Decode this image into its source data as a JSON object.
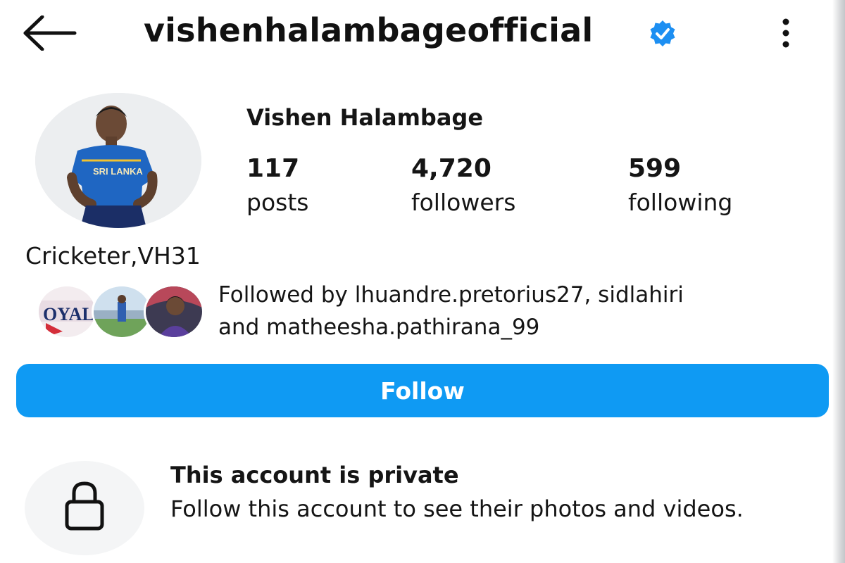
{
  "header": {
    "username": "vishenhalambageofficial",
    "back_icon": "arrow-left-icon",
    "verified_icon": "verified-badge-icon",
    "more_icon": "more-vertical-icon"
  },
  "profile": {
    "full_name": "Vishen Halambage",
    "bio": "Cricketer,VH31",
    "stats": [
      {
        "number": "117",
        "label": "posts"
      },
      {
        "number": "4,720",
        "label": "followers"
      },
      {
        "number": "599",
        "label": "following"
      }
    ],
    "followed_by_line1": "Followed by lhuandre.pretorius27, sidlahiri",
    "followed_by_line2": "and matheesha.pathirana_99"
  },
  "actions": {
    "follow_label": "Follow"
  },
  "private_notice": {
    "title": "This account is private",
    "description": "Follow this account to see their photos and videos.",
    "icon": "lock-icon"
  },
  "colors": {
    "accent": "#0F9AF3",
    "verified": "#1D8FF2",
    "text": "#151515",
    "background": "#FFFFFF",
    "lock_circle": "#F4F5F6"
  }
}
